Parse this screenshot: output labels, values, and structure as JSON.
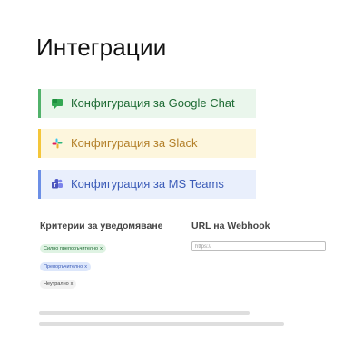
{
  "page": {
    "title": "Интеграции"
  },
  "integrations": [
    {
      "label": "Конфигурация за Google Chat",
      "icon": "google-chat-icon",
      "accent": "#52b26b"
    },
    {
      "label": "Конфигурация за Slack",
      "icon": "slack-icon",
      "accent": "#f4c63a"
    },
    {
      "label": "Конфигурация за MS Teams",
      "icon": "ms-teams-icon",
      "accent": "#6c8fe6"
    }
  ],
  "criteria": {
    "heading": "Критерии за уведомяване",
    "chips": [
      {
        "label": "Силно препоръчително",
        "remove": "x"
      },
      {
        "label": "Препоръчително",
        "remove": "x"
      },
      {
        "label": "Неутрално",
        "remove": "x"
      }
    ]
  },
  "webhook": {
    "heading_prefix": "URL на ",
    "heading_strong": "Webhook",
    "placeholder": "https://",
    "value": ""
  }
}
